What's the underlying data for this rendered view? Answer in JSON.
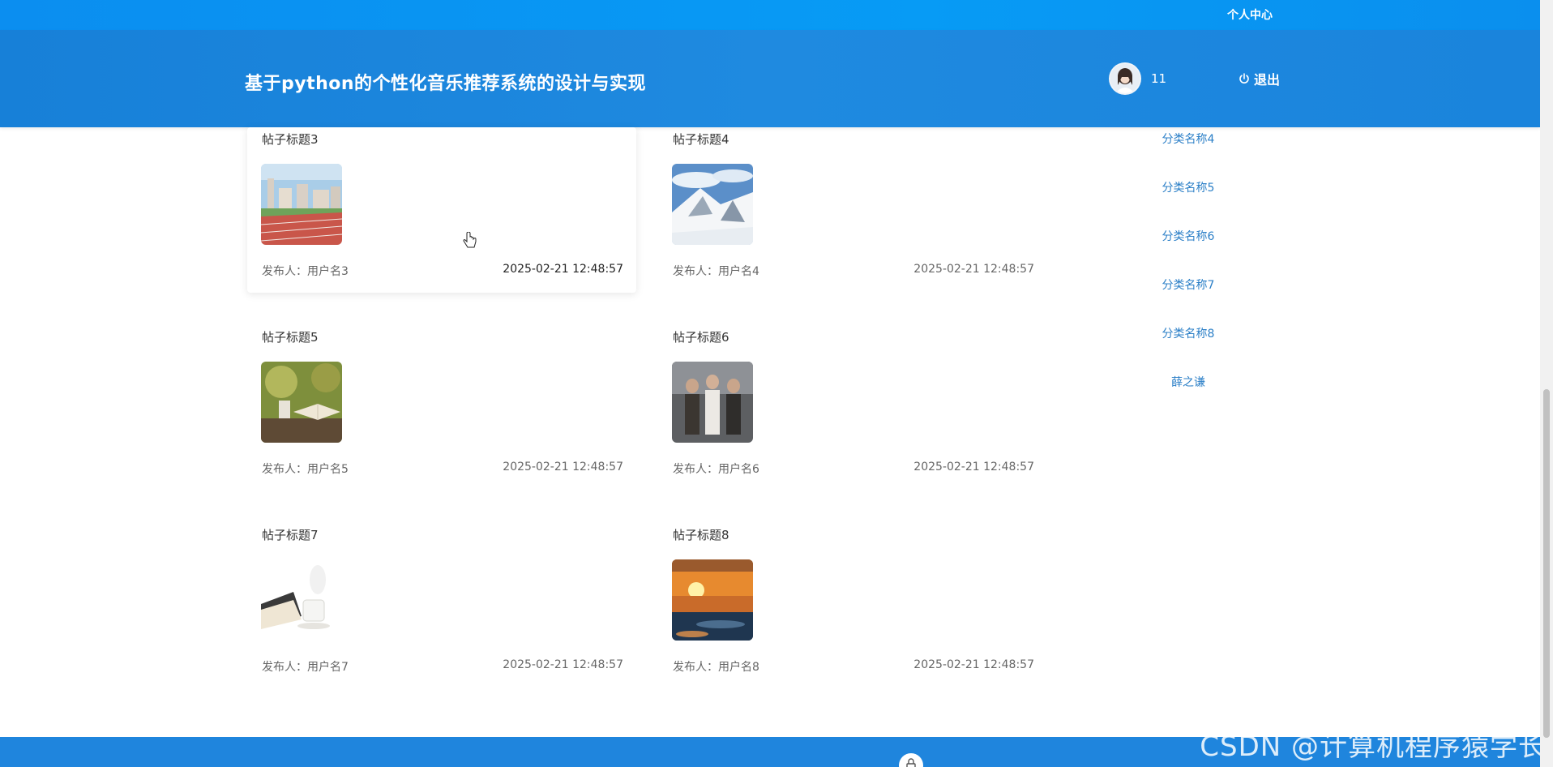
{
  "topbar": {
    "personal_center": "个人中心"
  },
  "header": {
    "title": "基于python的个性化音乐推荐系统的设计与实现",
    "username": "11",
    "logout": "退出"
  },
  "posts": [
    {
      "title": "帖子标题3",
      "author": "发布人：用户名3",
      "time": "2025-02-21 12:48:57",
      "image": "running-track-campus"
    },
    {
      "title": "帖子标题4",
      "author": "发布人：用户名4",
      "time": "2025-02-21 12:48:57",
      "image": "snowy-mountain"
    },
    {
      "title": "帖子标题5",
      "author": "发布人：用户名5",
      "time": "2025-02-21 12:48:57",
      "image": "open-book-garden"
    },
    {
      "title": "帖子标题6",
      "author": "发布人：用户名6",
      "time": "2025-02-21 12:48:57",
      "image": "three-people-poster"
    },
    {
      "title": "帖子标题7",
      "author": "发布人：用户名7",
      "time": "2025-02-21 12:48:57",
      "image": "book-and-coffee-cup"
    },
    {
      "title": "帖子标题8",
      "author": "发布人：用户名8",
      "time": "2025-02-21 12:48:57",
      "image": "sunset-sea"
    }
  ],
  "categories": [
    "分类名称4",
    "分类名称5",
    "分类名称6",
    "分类名称7",
    "分类名称8",
    "薛之谦"
  ],
  "watermark": "CSDN @计算机程序猿学长",
  "colors": {
    "primary": "#1f85dd",
    "link": "#2b7fc7"
  }
}
